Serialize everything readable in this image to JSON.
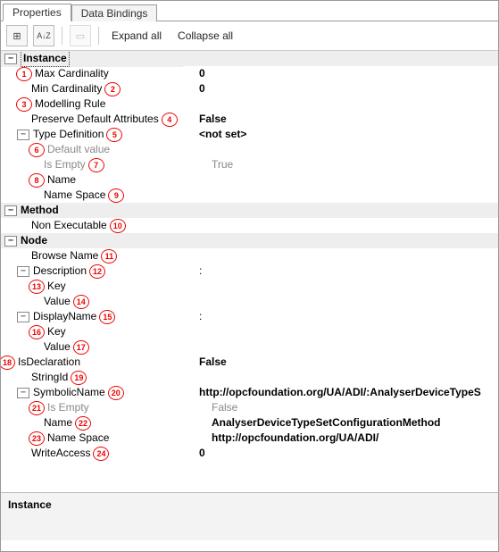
{
  "tabs": {
    "properties": "Properties",
    "data_bindings": "Data Bindings"
  },
  "toolbar": {
    "expand": "Expand all",
    "collapse": "Collapse all",
    "cat_sort_label": "Categorized",
    "az_label": "A↓Z",
    "doc_label": "New"
  },
  "markers": [
    "1",
    "2",
    "3",
    "4",
    "5",
    "6",
    "7",
    "8",
    "9",
    "10",
    "11",
    "12",
    "13",
    "14",
    "15",
    "16",
    "17",
    "18",
    "19",
    "20",
    "21",
    "22",
    "23",
    "24"
  ],
  "rows": {
    "instance": "Instance",
    "max_card": "Max Cardinality",
    "max_card_v": "0",
    "min_card": "Min Cardinality",
    "min_card_v": "0",
    "modelling": "Modelling Rule",
    "preserve": "Preserve Default Attributes",
    "preserve_v": "False",
    "typedef": "Type Definition",
    "typedef_v": "<not set>",
    "defval": "Default value",
    "isempty": "Is Empty",
    "isempty_v": "True",
    "name": "Name",
    "namespace": "Name Space",
    "method": "Method",
    "nonexec": "Non Executable",
    "node": "Node",
    "browsename": "Browse Name",
    "description": "Description",
    "description_v": ":",
    "key": "Key",
    "value": "Value",
    "displayname": "DisplayName",
    "displayname_v": ":",
    "isdecl": "IsDeclaration",
    "isdecl_v": "False",
    "stringid": "StringId",
    "symname": "SymbolicName",
    "symname_v": "http://opcfoundation.org/UA/ADI/:AnalyserDeviceTypeS",
    "sym_isempty": "Is Empty",
    "sym_isempty_v": "False",
    "sym_name": "Name",
    "sym_name_v": "AnalyserDeviceTypeSetConfigurationMethod",
    "sym_ns": "Name Space",
    "sym_ns_v": "http://opcfoundation.org/UA/ADI/",
    "writeaccess": "WriteAccess",
    "writeaccess_v": "0"
  },
  "description_panel": {
    "title": "Instance"
  }
}
